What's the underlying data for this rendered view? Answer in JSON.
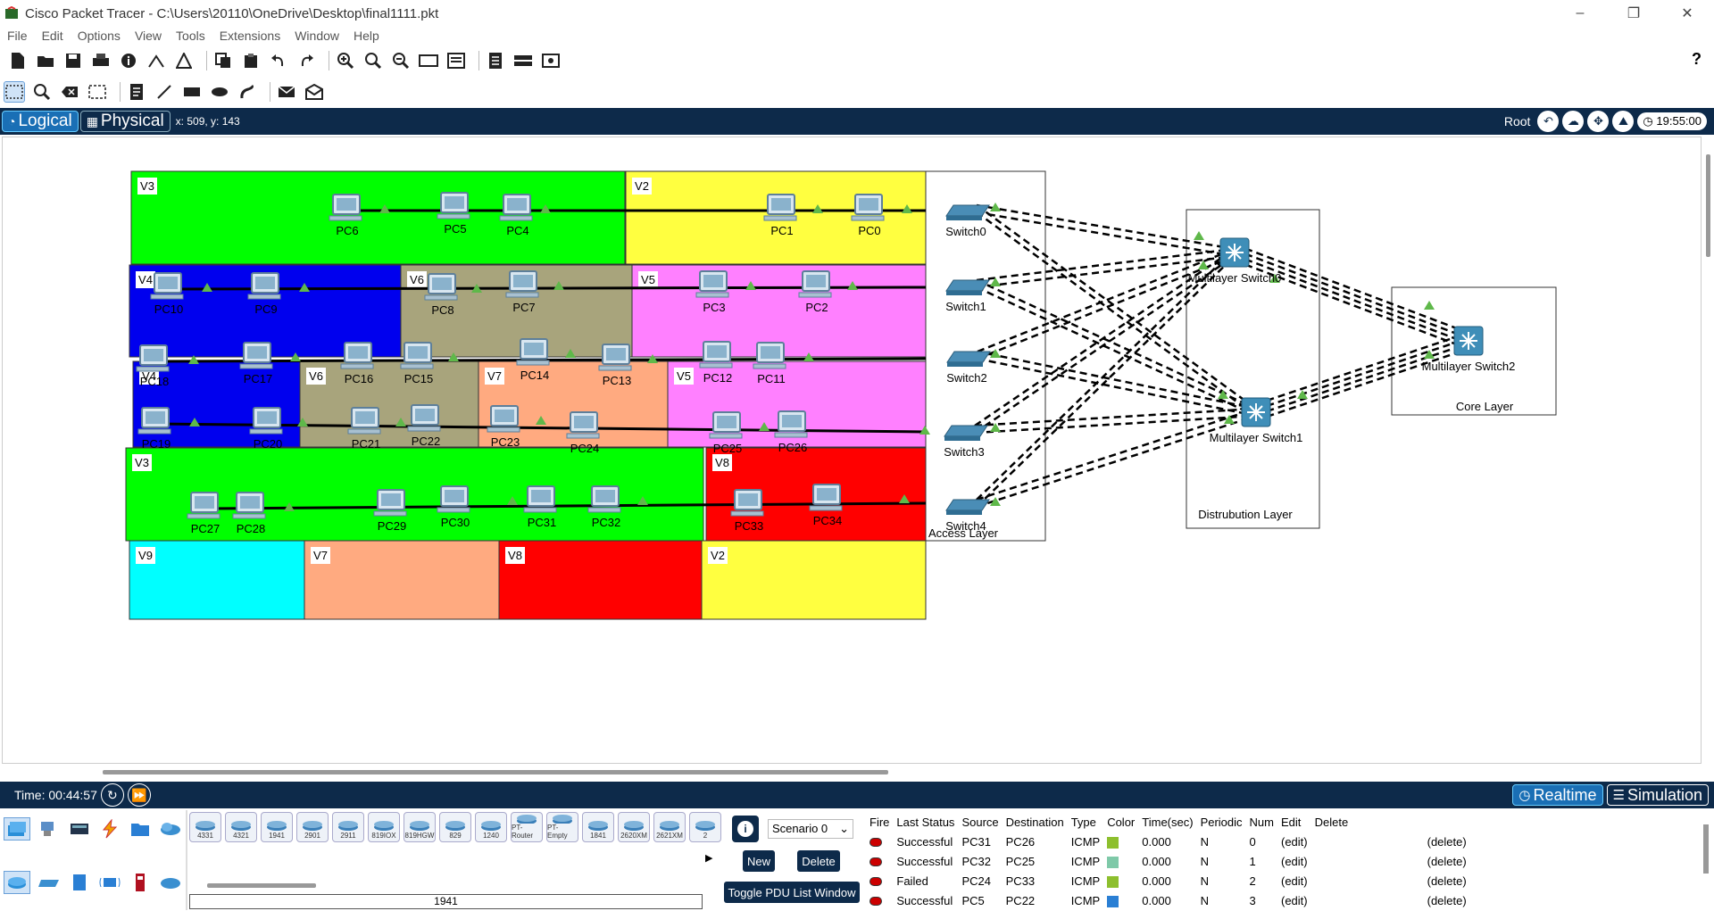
{
  "titlebar": {
    "title": "Cisco Packet Tracer - C:\\Users\\20110\\OneDrive\\Desktop\\final1111.pkt",
    "minimize_icon": "minimize-icon",
    "maximize_icon": "restore-icon",
    "close_icon": "close-icon"
  },
  "menu": [
    "File",
    "Edit",
    "Options",
    "View",
    "Tools",
    "Extensions",
    "Window",
    "Help"
  ],
  "modebar": {
    "logical": "Logical",
    "physical": "Physical",
    "coords": "x: 509, y: 143",
    "root": "Root",
    "clock": "19:55:00"
  },
  "zones": [
    {
      "label": "V3",
      "color": "#00ff00"
    },
    {
      "label": "V2",
      "color": "#ffff40"
    },
    {
      "label": "V4",
      "color": "#0000ee"
    },
    {
      "label": "V6",
      "color": "#a8a47c"
    },
    {
      "label": "V5",
      "color": "#ff80ff"
    },
    {
      "label": "V4",
      "color": "#0000ee"
    },
    {
      "label": "V6",
      "color": "#a8a47c"
    },
    {
      "label": "V7",
      "color": "#ffaa80"
    },
    {
      "label": "V5",
      "color": "#ff80ff"
    },
    {
      "label": "V3",
      "color": "#00ff00"
    },
    {
      "label": "V8",
      "color": "#ff0000"
    },
    {
      "label": "V9",
      "color": "#00ffff"
    },
    {
      "label": "V7",
      "color": "#ffaa80"
    },
    {
      "label": "V8",
      "color": "#ff0000"
    },
    {
      "label": "V2",
      "color": "#ffff40"
    }
  ],
  "layers": {
    "access": "Access Layer",
    "distribution": "Distrubution Layer",
    "core": "Core Layer"
  },
  "pcs": [
    {
      "name": "PC6"
    },
    {
      "name": "PC5"
    },
    {
      "name": "PC4"
    },
    {
      "name": "PC1"
    },
    {
      "name": "PC0"
    },
    {
      "name": "PC10"
    },
    {
      "name": "PC9"
    },
    {
      "name": "PC8"
    },
    {
      "name": "PC7"
    },
    {
      "name": "PC3"
    },
    {
      "name": "PC2"
    },
    {
      "name": "PC18"
    },
    {
      "name": "PC17"
    },
    {
      "name": "PC16"
    },
    {
      "name": "PC15"
    },
    {
      "name": "PC14"
    },
    {
      "name": "PC13"
    },
    {
      "name": "PC12"
    },
    {
      "name": "PC11"
    },
    {
      "name": "PC19"
    },
    {
      "name": "PC20"
    },
    {
      "name": "PC21"
    },
    {
      "name": "PC22"
    },
    {
      "name": "PC23"
    },
    {
      "name": "PC24"
    },
    {
      "name": "PC25"
    },
    {
      "name": "PC26"
    },
    {
      "name": "PC27"
    },
    {
      "name": "PC28"
    },
    {
      "name": "PC29"
    },
    {
      "name": "PC30"
    },
    {
      "name": "PC31"
    },
    {
      "name": "PC32"
    },
    {
      "name": "PC33"
    },
    {
      "name": "PC34"
    }
  ],
  "switches": [
    {
      "name": "Switch0"
    },
    {
      "name": "Switch1"
    },
    {
      "name": "Switch2"
    },
    {
      "name": "Switch3"
    },
    {
      "name": "Switch4"
    }
  ],
  "multilayer": [
    {
      "name": "Multilayer Switch0"
    },
    {
      "name": "Multilayer Switch1"
    },
    {
      "name": "Multilayer Switch2"
    }
  ],
  "bottombar": {
    "time": "Time: 00:44:57",
    "realtime": "Realtime",
    "simulation": "Simulation"
  },
  "device_models": [
    "4331",
    "4321",
    "1941",
    "2901",
    "2911",
    "819IOX",
    "819HGW",
    "829",
    "1240",
    "PT-Router",
    "PT-Empty",
    "1841",
    "2620XM",
    "2621XM",
    "2"
  ],
  "selected_model": "1941",
  "sim": {
    "scenario": "Scenario 0",
    "new": "New",
    "delete": "Delete",
    "toggle": "Toggle PDU List Window"
  },
  "pdu_headers": [
    "Fire",
    "Last Status",
    "Source",
    "Destination",
    "Type",
    "Color",
    "Time(sec)",
    "Periodic",
    "Num",
    "Edit",
    "Delete"
  ],
  "pdu_rows": [
    {
      "status": "Successful",
      "source": "PC31",
      "dest": "PC26",
      "type": "ICMP",
      "color": "#8dbf2e",
      "time": "0.000",
      "periodic": "N",
      "num": "0",
      "edit": "(edit)",
      "delete": "(delete)"
    },
    {
      "status": "Successful",
      "source": "PC32",
      "dest": "PC25",
      "type": "ICMP",
      "color": "#7fc9a8",
      "time": "0.000",
      "periodic": "N",
      "num": "1",
      "edit": "(edit)",
      "delete": "(delete)"
    },
    {
      "status": "Failed",
      "source": "PC24",
      "dest": "PC33",
      "type": "ICMP",
      "color": "#8dbf2e",
      "time": "0.000",
      "periodic": "N",
      "num": "2",
      "edit": "(edit)",
      "delete": "(delete)"
    },
    {
      "status": "Successful",
      "source": "PC5",
      "dest": "PC22",
      "type": "ICMP",
      "color": "#2a7fd4",
      "time": "0.000",
      "periodic": "N",
      "num": "3",
      "edit": "(edit)",
      "delete": "(delete)"
    }
  ]
}
